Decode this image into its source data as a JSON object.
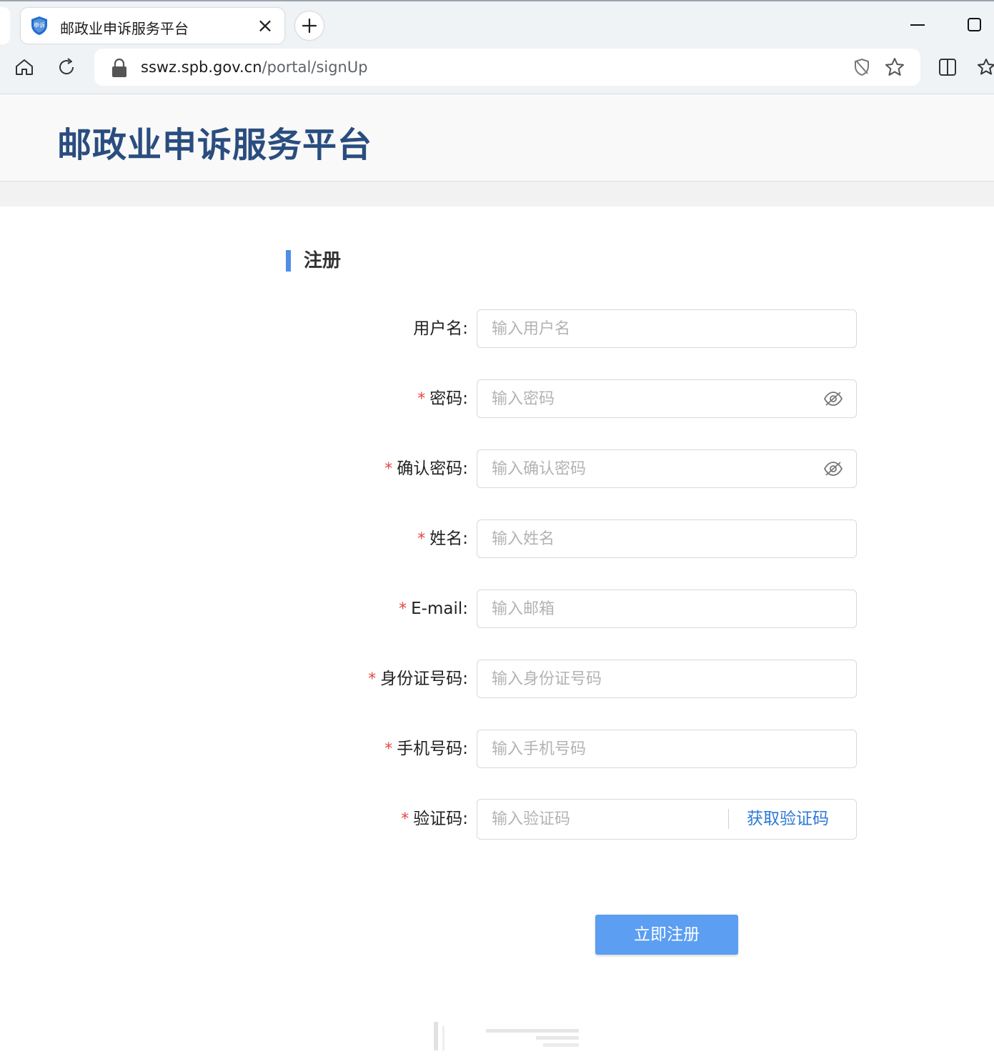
{
  "browser": {
    "tab_title": "邮政业申诉服务平台",
    "favicon_text": "申诉",
    "url_host": "sswz.spb.gov.cn",
    "url_path": "/portal/signUp"
  },
  "header": {
    "site_title": "邮政业申诉服务平台"
  },
  "form": {
    "section_title": "注册",
    "fields": [
      {
        "label": "用户名:",
        "required": false,
        "placeholder": "输入用户名"
      },
      {
        "label": "密码:",
        "required": true,
        "placeholder": "输入密码"
      },
      {
        "label": "确认密码:",
        "required": true,
        "placeholder": "输入确认密码"
      },
      {
        "label": "姓名:",
        "required": true,
        "placeholder": "输入姓名"
      },
      {
        "label": "E-mail:",
        "required": true,
        "placeholder": "输入邮箱"
      },
      {
        "label": "身份证号码:",
        "required": true,
        "placeholder": "输入身份证号码"
      },
      {
        "label": "手机号码:",
        "required": true,
        "placeholder": "输入手机号码"
      },
      {
        "label": "验证码:",
        "required": true,
        "placeholder": "输入验证码"
      }
    ],
    "required_mark": "*",
    "get_code_label": "获取验证码",
    "submit_label": "立即注册"
  },
  "colors": {
    "site_title": "#2a4d7f",
    "accent_bar": "#4d8fe8",
    "submit_bg": "#5b9ef2",
    "link": "#2e79d6",
    "required": "#e64545"
  }
}
